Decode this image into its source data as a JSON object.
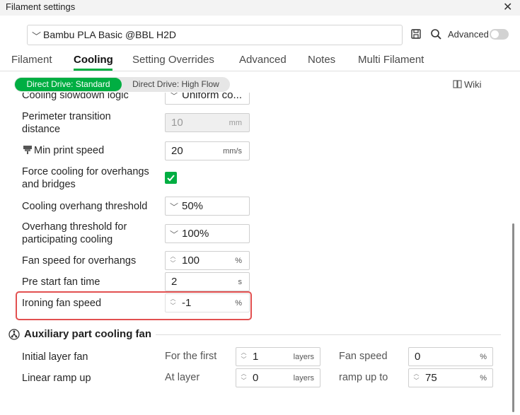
{
  "window": {
    "title": "Filament settings"
  },
  "preset": {
    "value": "Bambu PLA Basic @BBL H2D"
  },
  "header": {
    "advanced_label": "Advanced"
  },
  "tabs": [
    {
      "label": "Filament"
    },
    {
      "label": "Cooling"
    },
    {
      "label": "Setting Overrides"
    },
    {
      "label": "Advanced"
    },
    {
      "label": "Notes"
    },
    {
      "label": "Multi Filament"
    }
  ],
  "extruder": {
    "options": [
      "Direct Drive: Standard",
      "Direct Drive: High Flow"
    ],
    "selected": "Direct Drive: Standard"
  },
  "wiki_label": "Wiki",
  "settings": {
    "slowdown": {
      "label": "Cooling slowdown logic",
      "value": "Uniform co..."
    },
    "perimeter": {
      "label_line1": "Perimeter transition",
      "label_line2": "distance",
      "value": "10",
      "unit": "mm"
    },
    "min_speed": {
      "label": "Min print speed",
      "value": "20",
      "unit": "mm/s"
    },
    "force_cooling": {
      "label_line1": "Force cooling for overhangs",
      "label_line2": "and bridges",
      "checked": true
    },
    "overhang_threshold": {
      "label": "Cooling overhang threshold",
      "value": "50%"
    },
    "overhang_participating": {
      "label_line1": "Overhang threshold for",
      "label_line2": "participating cooling",
      "value": "100%"
    },
    "fan_overhangs": {
      "label": "Fan speed for overhangs",
      "value": "100",
      "unit": "%"
    },
    "pre_start": {
      "label": "Pre start fan time",
      "value": "2",
      "unit": "s"
    },
    "ironing_fan": {
      "label": "Ironing fan speed",
      "value": "-1",
      "unit": "%"
    }
  },
  "aux": {
    "title": "Auxiliary part cooling fan",
    "initial": {
      "label": "Initial layer fan",
      "sub": "For the first",
      "value": "1",
      "unit": "layers",
      "fan_label": "Fan speed",
      "fan_value": "0",
      "fan_unit": "%"
    },
    "ramp": {
      "label": "Linear ramp up",
      "sub": "At layer",
      "value": "0",
      "unit": "layers",
      "fan_label": "ramp up to",
      "fan_value": "75",
      "fan_unit": "%"
    }
  },
  "colors": {
    "accent": "#00ae42",
    "highlight": "#e25050"
  }
}
